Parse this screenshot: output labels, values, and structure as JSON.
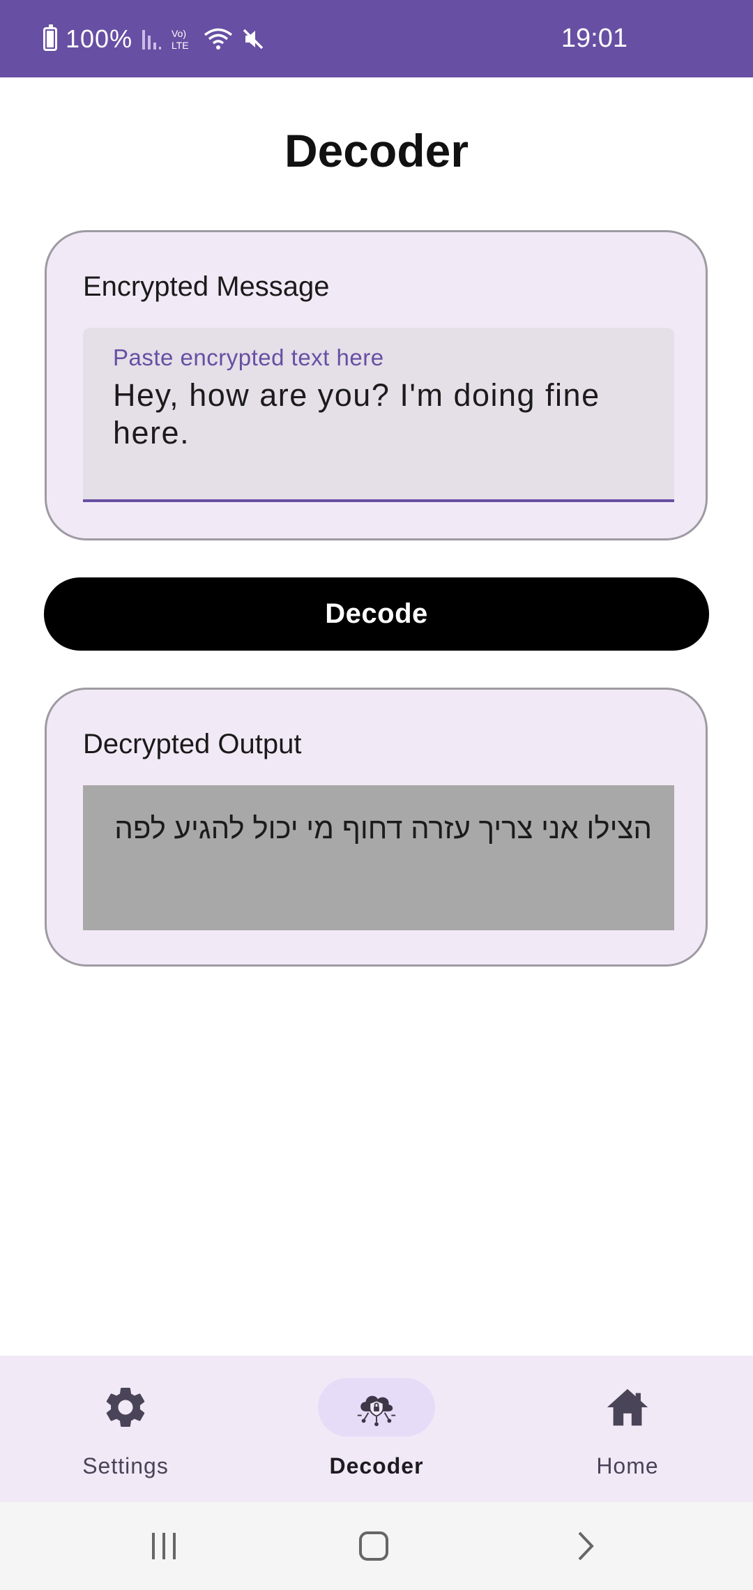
{
  "status_bar": {
    "battery_percent": "100%",
    "time": "19:01",
    "icons": [
      "battery-icon",
      "signal-icon",
      "volte-icon",
      "wifi-icon",
      "mute-icon"
    ]
  },
  "page": {
    "title": "Decoder"
  },
  "encrypted_card": {
    "label": "Encrypted Message",
    "placeholder": "Paste encrypted text here",
    "value": "Hey, how are you? I'm doing fine here."
  },
  "decode_button": {
    "label": "Decode"
  },
  "decrypted_card": {
    "label": "Decrypted Output",
    "value": "הצילו אני צריך עזרה דחוף מי יכול להגיע לפה"
  },
  "bottom_nav": {
    "items": [
      {
        "label": "Settings",
        "icon": "gear-icon",
        "active": false
      },
      {
        "label": "Decoder",
        "icon": "decoder-cloud-icon",
        "active": true
      },
      {
        "label": "Home",
        "icon": "home-icon",
        "active": false
      }
    ]
  },
  "system_nav": {
    "icons": [
      "recents-icon",
      "home-button-icon",
      "back-icon"
    ]
  },
  "colors": {
    "accent": "#674fa3",
    "card_background": "#f2e9f7",
    "button_background": "#000000",
    "output_background": "#a8a8a8"
  }
}
